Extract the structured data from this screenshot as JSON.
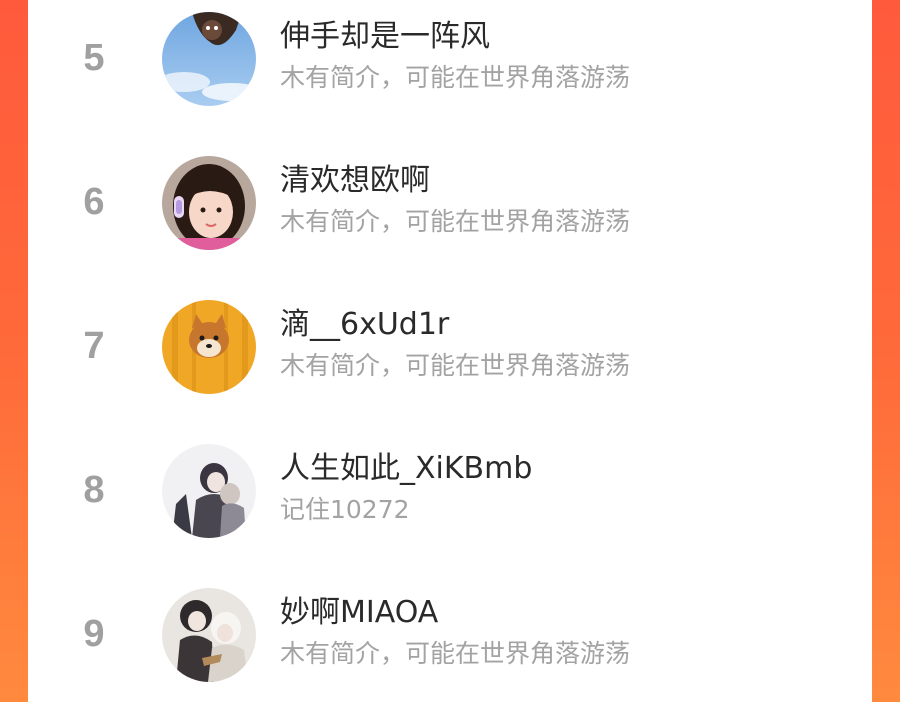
{
  "ranking": {
    "items": [
      {
        "rank": "5",
        "name": "伸手却是一阵风",
        "bio": "木有简介，可能在世界角落游荡",
        "avatar": "sky-cat-avatar"
      },
      {
        "rank": "6",
        "name": "清欢想欧啊",
        "bio": "木有简介，可能在世界角落游荡",
        "avatar": "girl-headphones-avatar"
      },
      {
        "rank": "7",
        "name": "滴__6xUd1r",
        "bio": "木有简介，可能在世界角落游荡",
        "avatar": "shiba-dog-avatar"
      },
      {
        "rank": "8",
        "name": "人生如此_XiKBmb",
        "bio": "记住10272",
        "avatar": "anime-couple-avatar"
      },
      {
        "rank": "9",
        "name": "妙啊MIAOA",
        "bio": "木有简介，可能在世界角落游荡",
        "avatar": "anime-duo-avatar"
      }
    ]
  },
  "colors": {
    "background_gradient_top": "#ff5a3c",
    "background_gradient_bottom": "#ff8a3e",
    "panel": "#ffffff",
    "rank_text": "#a0a0a0",
    "name_text": "#2a2a2a",
    "bio_text": "#a3a3a3"
  }
}
